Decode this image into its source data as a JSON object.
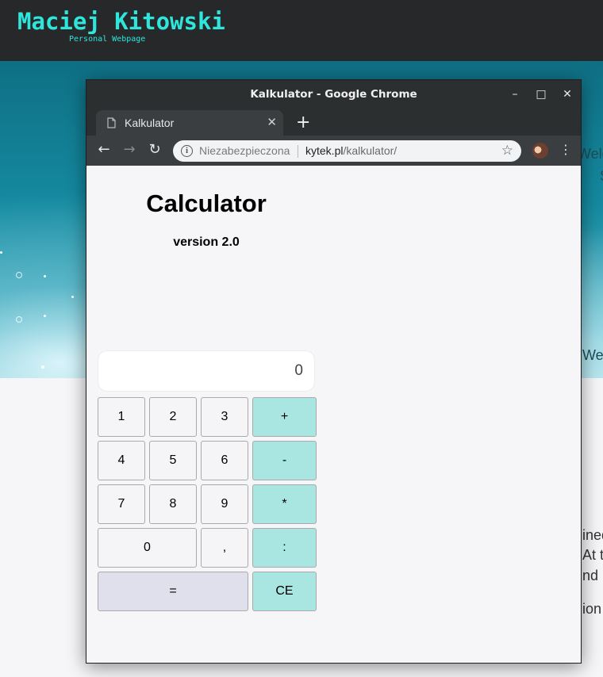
{
  "site": {
    "title": "Maciej Kitowski",
    "subtitle": "Personal Webpage",
    "partial_texts": [
      "Welco",
      "S",
      "Web",
      "ined",
      "At t",
      "nd U",
      "ion"
    ]
  },
  "browser": {
    "window_title": "Kalkulator - Google Chrome",
    "tab_label": "Kalkulator",
    "security_label": "Niezabezpieczona",
    "url_host": "kytek.pl",
    "url_path": "/kalkulator/",
    "icons": {
      "minimize": "–",
      "maximize": "□",
      "close": "✕",
      "tab_close": "✕",
      "new_tab": "+",
      "back": "←",
      "forward": "→",
      "reload": "↻",
      "star": "☆",
      "menu": "⋮"
    }
  },
  "calculator": {
    "title": "Calculator",
    "version": "version 2.0",
    "display_value": "0",
    "keys": {
      "k1": "1",
      "k2": "2",
      "k3": "3",
      "plus": "+",
      "k4": "4",
      "k5": "5",
      "k6": "6",
      "minus": "-",
      "k7": "7",
      "k8": "8",
      "k9": "9",
      "multiply": "*",
      "k0": "0",
      "comma": ",",
      "divide": ":",
      "equals": "=",
      "clear": "CE"
    },
    "colors": {
      "operator_bg": "#a9e5e1",
      "equals_bg": "#dfe0ec",
      "digit_bg": "#f5f5f7"
    }
  }
}
